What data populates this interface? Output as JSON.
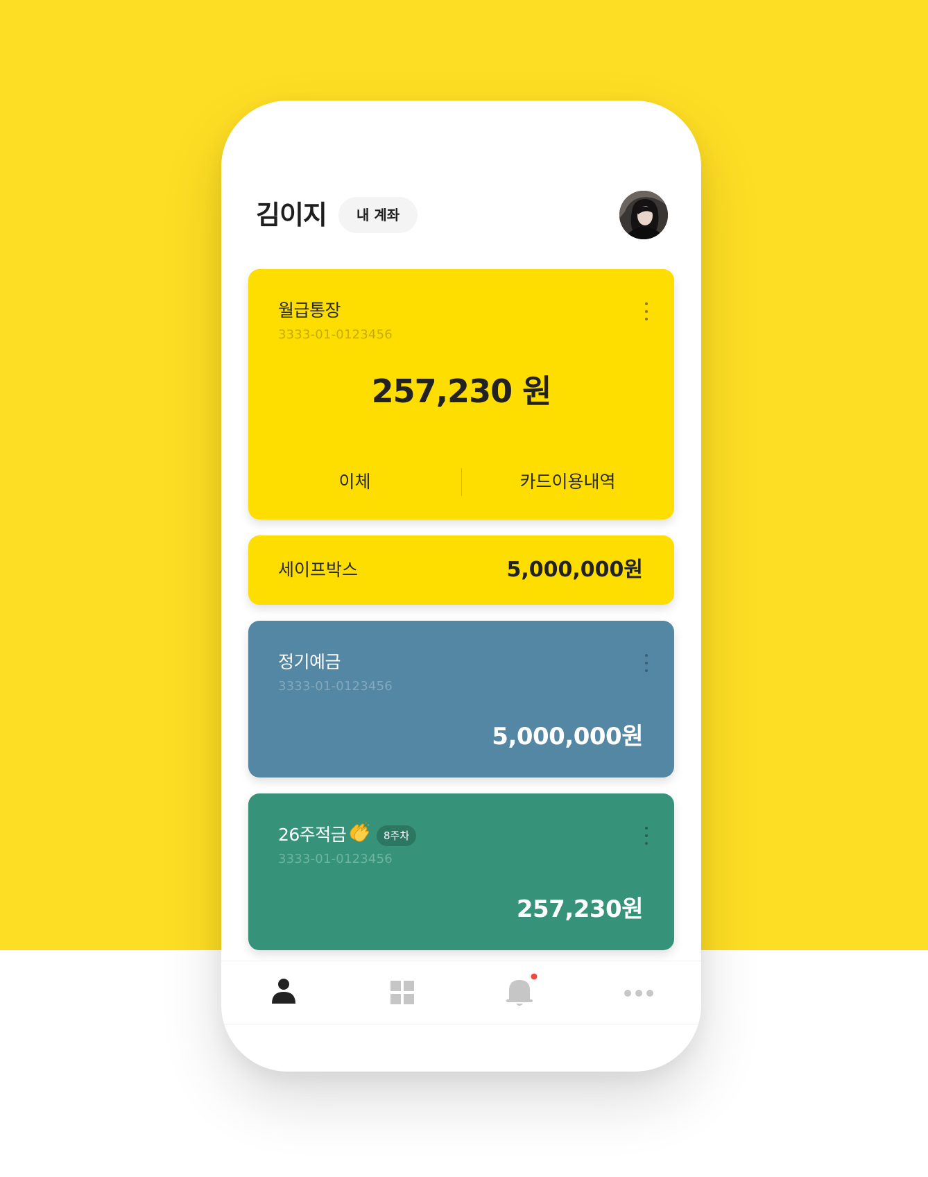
{
  "header": {
    "user_name": "김이지",
    "account_pill": "내 계좌"
  },
  "accounts": {
    "salary": {
      "name": "월급통장",
      "number": "3333-01-0123456",
      "balance": "257,230 원",
      "actions": [
        "이체",
        "카드이용내역"
      ]
    },
    "safebox": {
      "name": "세이프박스",
      "amount": "5,000,000원"
    },
    "deposit": {
      "name": "정기예금",
      "number": "3333-01-0123456",
      "amount": "5,000,000원"
    },
    "savings": {
      "name": "26주적금",
      "week_badge": "8주차",
      "number": "3333-01-0123456",
      "amount": "257,230원"
    }
  },
  "tabbar": {
    "icons": [
      "person-icon",
      "grid-icon",
      "bell-icon",
      "more-icon"
    ],
    "notification_dot_color": "#F04A3E"
  },
  "colors": {
    "background_yellow": "#FEDE24",
    "card_yellow": "#FEDE00",
    "card_blue": "#5487A3",
    "card_green": "#36937A"
  }
}
